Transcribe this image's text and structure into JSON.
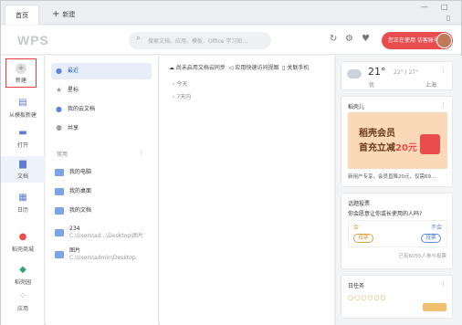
{
  "titlebar": {
    "tab_home": "首页",
    "tab_new": "新建",
    "min": "—",
    "max": "□",
    "side": "▯"
  },
  "topbar": {
    "logo": "WPS",
    "search_placeholder": "搜索文档、应用、模板、Office 学习知...",
    "account_label": "您正在使用 访客账号"
  },
  "rail": {
    "new": "新建",
    "from_template": "从模板新建",
    "open": "打开",
    "docs": "文档",
    "calendar": "日历",
    "shell_store": "稻壳商城",
    "app_center": "稻壳园",
    "apps": "应用"
  },
  "nav": {
    "recent": "最近",
    "starred": "星标",
    "cloud_docs": "我的云文档",
    "shared": "共享",
    "common_section": "常用",
    "my_computer": "我的电脑",
    "my_desktop": "我的桌面",
    "my_documents": "我的文档",
    "folder_234_name": "234",
    "folder_234_path": "C:\\Users\\ad...\\Desktop\\图片",
    "folder_pics_name": "图片",
    "folder_pics_path": "C:\\Users\\admin\\Desktop"
  },
  "main": {
    "cloud_sync": "尚未启用文档云同步",
    "quick_access": "应用快速访问视图",
    "close_phone": "关联手机",
    "today": "今天",
    "last7": "7天内"
  },
  "weather": {
    "temp": "21°",
    "range": "22° / 27°",
    "cond": "优",
    "city": "上海"
  },
  "membership": {
    "header": "稻壳儿",
    "ad_line1": "稻壳会员",
    "ad_line2a": "首充立减",
    "ad_line2b": "20元",
    "footer": "新用户专享，会员直降20元，仅需69..."
  },
  "poll": {
    "header": "话题投票",
    "question": "你会愿意让你或长使用的人吗?",
    "yes": "会",
    "no": "不会",
    "vote_yes": "投票",
    "vote_no": "投票",
    "count": "已有6055人参与投票"
  },
  "tasks": {
    "header": "日任务",
    "row": "○○○○○○"
  }
}
